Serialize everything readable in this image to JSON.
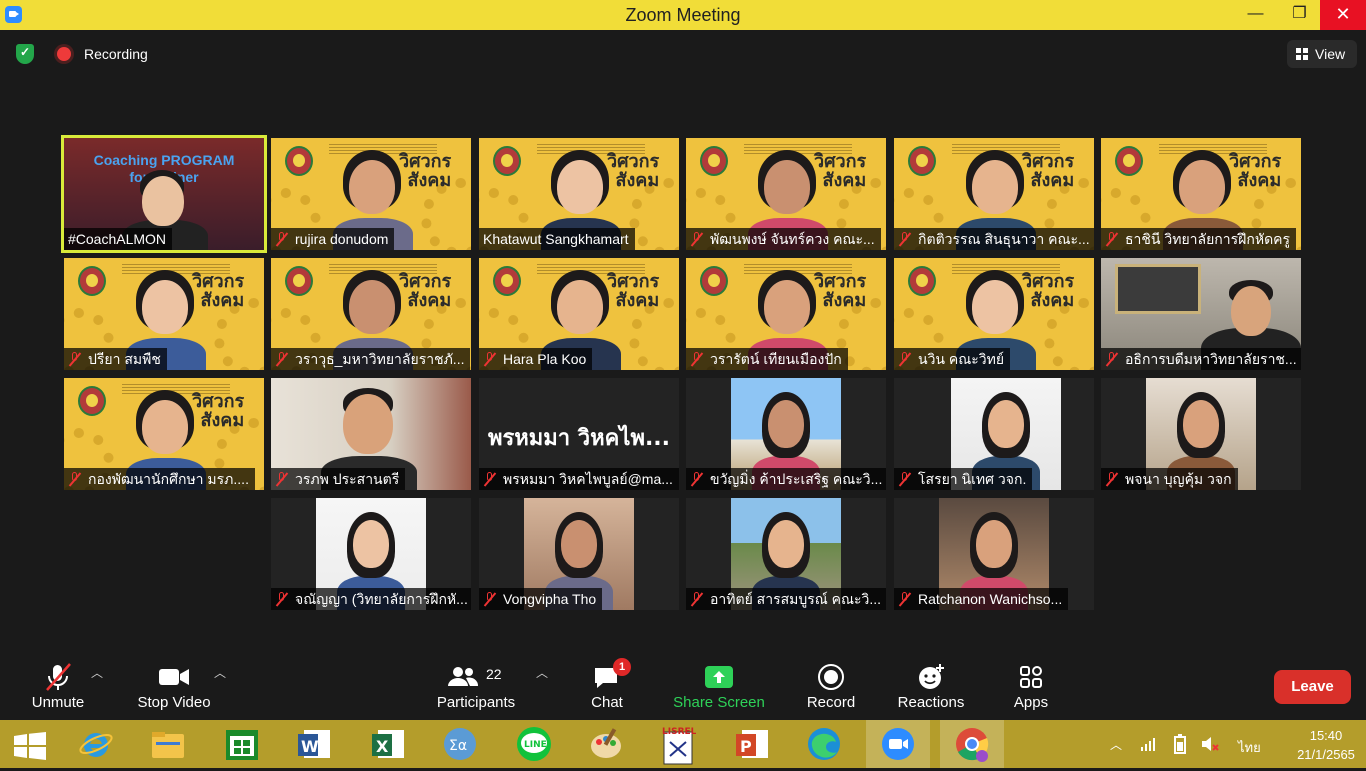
{
  "window": {
    "title": "Zoom Meeting",
    "minimize": "—",
    "maximize": "❐",
    "close": "✕"
  },
  "topbar": {
    "recording_label": "Recording",
    "view_label": "View"
  },
  "participants": [
    {
      "name": "#CoachALMON",
      "muted": false,
      "kind": "share",
      "active": true
    },
    {
      "name": "rujira donudom",
      "muted": true,
      "kind": "yellow"
    },
    {
      "name": "Khatawut Sangkhamart",
      "muted": false,
      "kind": "yellow"
    },
    {
      "name": "พัฒนพงษ์ จันทร์ควง คณะ...",
      "muted": true,
      "kind": "yellow"
    },
    {
      "name": "กิตติวรรณ สินธุนาวา คณะ...",
      "muted": true,
      "kind": "yellow"
    },
    {
      "name": "ธาชินี  วิทยาลัยการฝึกหัดครู",
      "muted": true,
      "kind": "yellow"
    },
    {
      "name": "ปรียา สมพืช",
      "muted": true,
      "kind": "yellow"
    },
    {
      "name": "วราวุธ_มหาวิทยาลัยราชภั...",
      "muted": true,
      "kind": "yellow"
    },
    {
      "name": "Hara Pla Koo",
      "muted": true,
      "kind": "yellow"
    },
    {
      "name": "วรารัตน์ เทียนเมืองปัก",
      "muted": true,
      "kind": "yellow"
    },
    {
      "name": "นวิน คณะวิทย์",
      "muted": true,
      "kind": "yellow"
    },
    {
      "name": "อธิการบดีมหาวิทยาลัยราช...",
      "muted": true,
      "kind": "office"
    },
    {
      "name": "กองพัฒนานักศึกษา มรภ....",
      "muted": true,
      "kind": "yellow"
    },
    {
      "name": "วรภพ ประสานตรี",
      "muted": true,
      "kind": "room"
    },
    {
      "name": "พรหมมา วิหคไพบูลย์@ma...",
      "muted": true,
      "kind": "text",
      "big_name": "พรหมมา วิหคไพ..."
    },
    {
      "name": "ขวัญมิ่ง ค้าประเสริฐ คณะวิ...",
      "muted": true,
      "kind": "opera"
    },
    {
      "name": "โสรยา นิเทศ วจก.",
      "muted": true,
      "kind": "portrait"
    },
    {
      "name": "พจนา บุญคุ้ม วจก",
      "muted": true,
      "kind": "portrait2"
    },
    {
      "name": "จณัญญา (วิทยาลัยการฝึกหั...",
      "muted": true,
      "kind": "portrait3"
    },
    {
      "name": "Vongvipha Tho",
      "muted": true,
      "kind": "portrait4"
    },
    {
      "name": "อาทิตย์ สารสมบูรณ์ คณะวิ...",
      "muted": true,
      "kind": "street"
    },
    {
      "name": "Ratchanon Wanichso...",
      "muted": true,
      "kind": "street2"
    }
  ],
  "banner_text": {
    "line1": "วิศวกร",
    "line2": "สังคม"
  },
  "share_text": {
    "line1": "Coaching PROGRAM",
    "line2": "for Trainer"
  },
  "controls": {
    "unmute": "Unmute",
    "stop_video": "Stop Video",
    "participants": "Participants",
    "participants_count": "22",
    "chat": "Chat",
    "chat_badge": "1",
    "share_screen": "Share Screen",
    "record": "Record",
    "reactions": "Reactions",
    "apps": "Apps",
    "leave": "Leave"
  },
  "taskbar": {
    "apps": [
      "windows-start",
      "internet-explorer",
      "file-explorer",
      "store",
      "word",
      "excel",
      "calculator-math",
      "line",
      "paint",
      "lisrel",
      "powerpoint",
      "edge",
      "zoom",
      "chrome"
    ],
    "tray_lang": "ไทย",
    "time": "15:40",
    "date": "21/1/2565"
  }
}
